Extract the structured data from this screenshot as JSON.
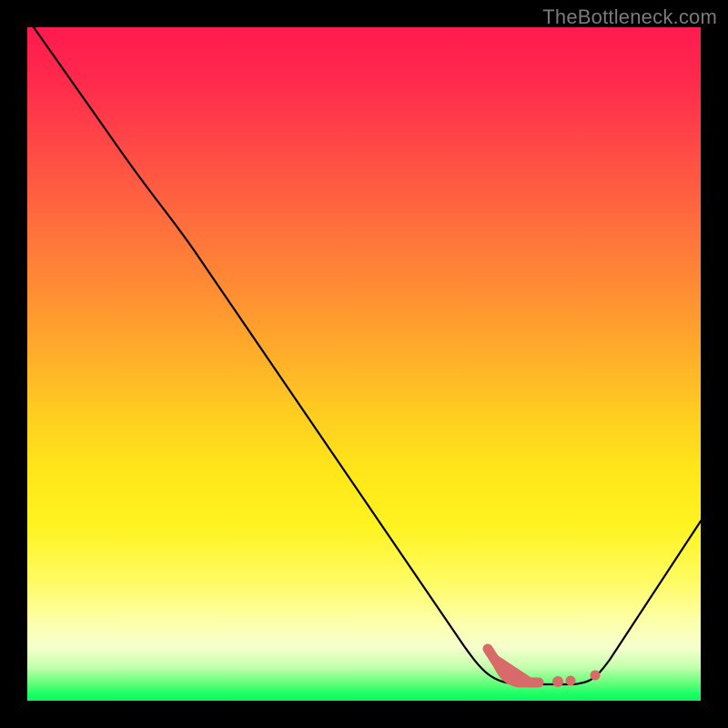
{
  "watermark": "TheBottleneck.com",
  "chart_data": {
    "type": "line",
    "title": "",
    "xlabel": "",
    "ylabel": "",
    "xlim": [
      0,
      100
    ],
    "ylim": [
      0,
      100
    ],
    "background": "vertical-gradient red→yellow→green (green = low bottleneck)",
    "series": [
      {
        "name": "bottleneck-curve",
        "x": [
          0,
          13,
          25,
          40,
          55,
          65,
          72,
          78,
          82,
          86,
          100
        ],
        "y": [
          101,
          83,
          72,
          50,
          28,
          8,
          2.5,
          2.5,
          3,
          6,
          28
        ]
      }
    ],
    "highlight_points": {
      "name": "optimal-range",
      "x": [
        69,
        71,
        73,
        76,
        79,
        81,
        84
      ],
      "y": [
        7.5,
        5,
        3,
        2.5,
        2.7,
        2.8,
        3.5
      ]
    },
    "grid": false,
    "legend": false
  }
}
